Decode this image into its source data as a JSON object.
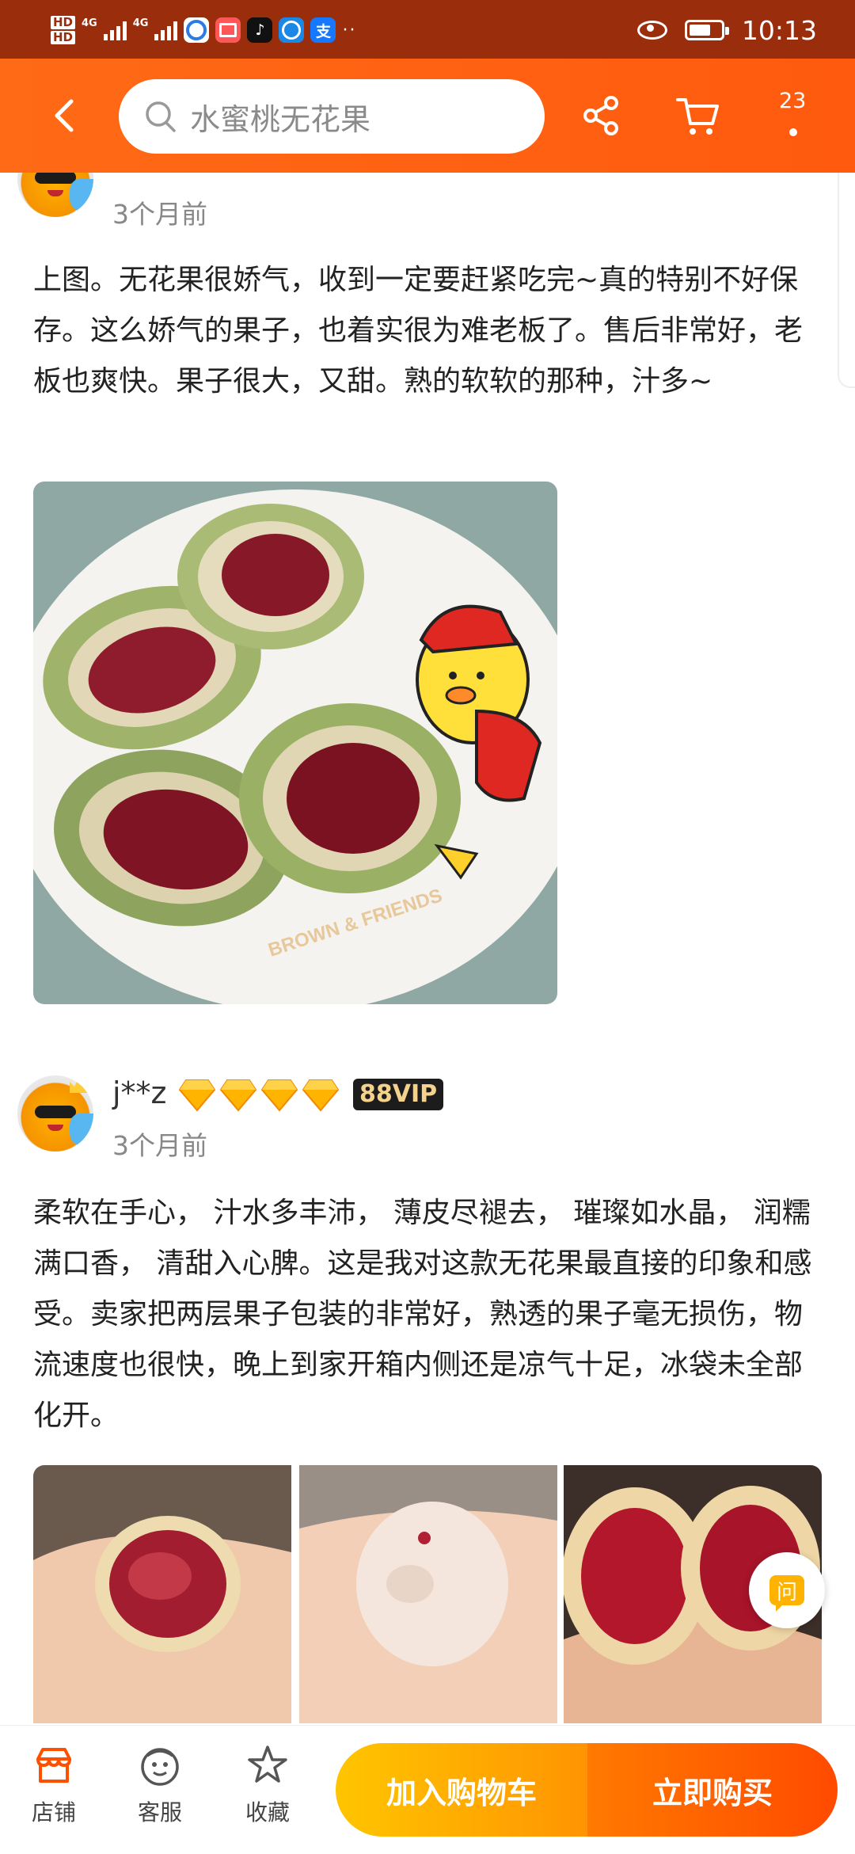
{
  "status_bar": {
    "hd1": "HD",
    "hd2": "HD",
    "net1": "4G",
    "net2": "4G",
    "apps": [
      "tiktok-icon",
      "book-icon",
      "douyin-icon",
      "browser-icon",
      "alipay-icon"
    ],
    "alipay_glyph": "支",
    "more": "··",
    "time": "10:13"
  },
  "top_nav": {
    "search_text": "水蜜桃无花果",
    "cart_count": "23"
  },
  "review1": {
    "time": "3个月前",
    "text": "上图。无花果很娇气，收到一定要赶紧吃完~真的特别不好保存。这么娇气的果子，也着实很为难老板了。售后非常好，老板也爽快。果子很大，又甜。熟的软软的那种，汁多~",
    "plate_text": "BROWN & FRIENDS"
  },
  "review2": {
    "username": "j**z",
    "badge": "88VIP",
    "time": "3个月前",
    "text": "柔软在手心， 汁水多丰沛， 薄皮尽褪去， 璀璨如水晶， 润糯满口香， 清甜入心脾。这是我对这款无花果最直接的印象和感受。卖家把两层果子包装的非常好，熟透的果子毫无损伤，物流速度也很快，晚上到家开箱内侧还是凉气十足，冰袋未全部化开。"
  },
  "ask_button": "问",
  "bottom_bar": {
    "store": "店铺",
    "service": "客服",
    "favorite": "收藏",
    "add_to_cart": "加入购物车",
    "buy_now": "立即购买"
  },
  "colors": {
    "nav_orange": "#ff6a16",
    "status_bar": "#9a2e0c",
    "cart_button": "#ffb000",
    "buy_button": "#ff5500",
    "store_icon": "#ff5000"
  }
}
